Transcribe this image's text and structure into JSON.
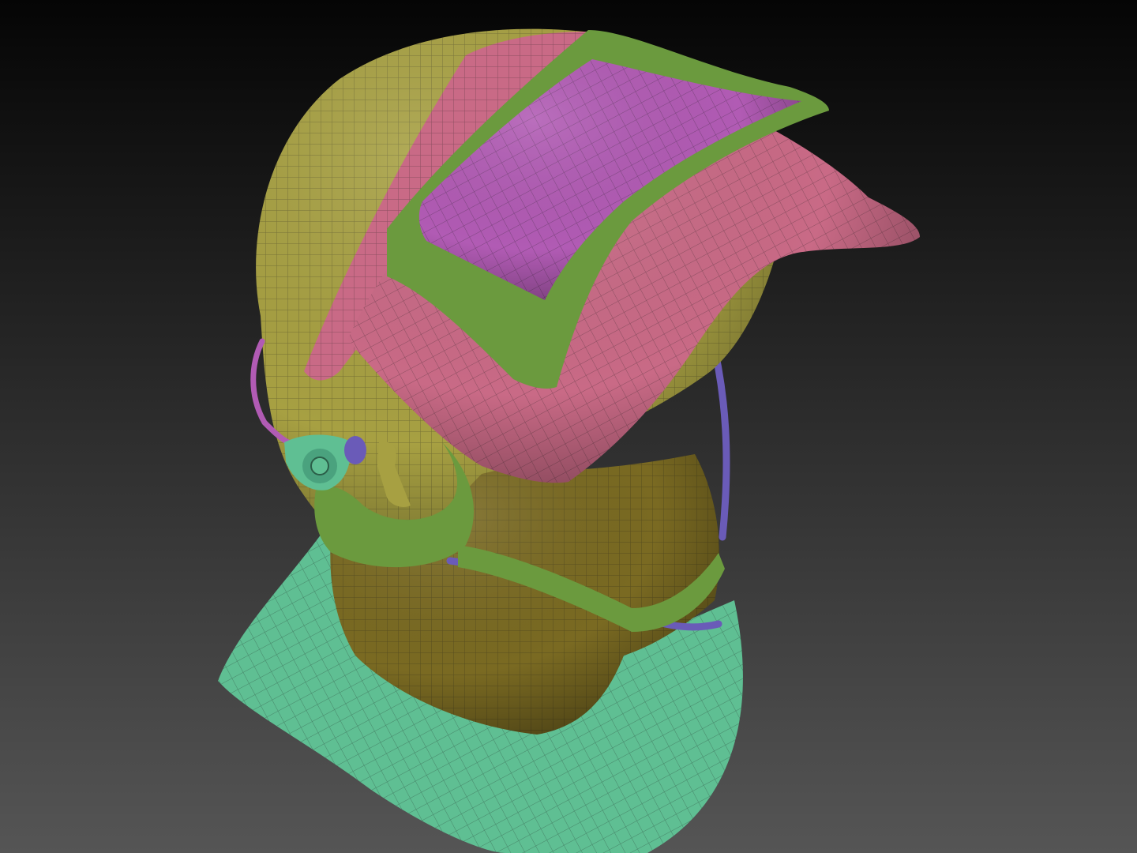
{
  "scene": {
    "subject": "helmet-headgear-model",
    "colors": {
      "background_top": "#050505",
      "background_bottom": "#555555",
      "shell_yellow": "#a7a042",
      "band_pink": "#c96a86",
      "visor_magenta": "#b15bb4",
      "frame_green": "#6b9a3e",
      "neck_teal": "#5fbf93",
      "cloth_brown": "#7a6a22",
      "strap_purple": "#6a5bb8",
      "wire_color": "#1a1a1a"
    }
  }
}
